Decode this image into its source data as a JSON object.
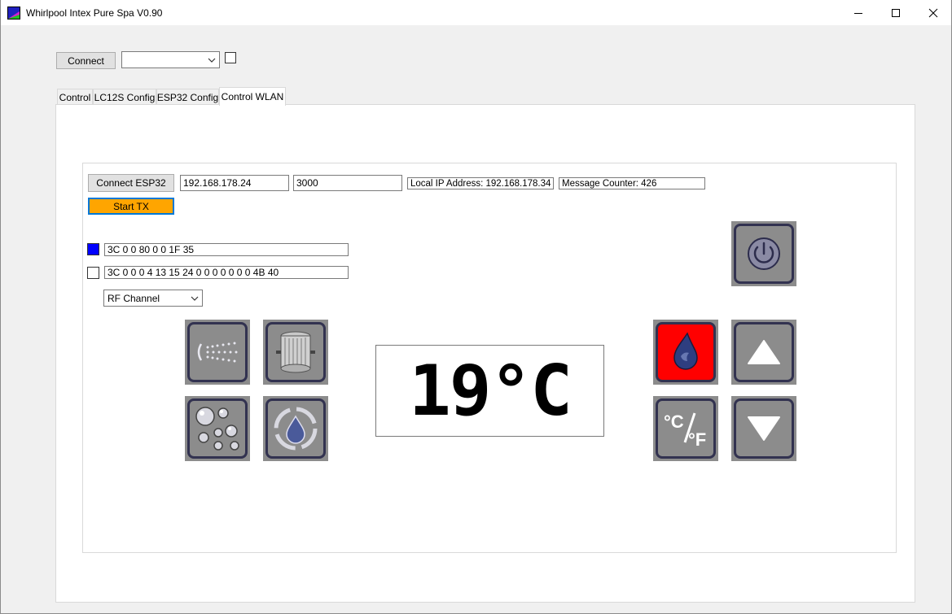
{
  "window": {
    "title": "Whirlpool Intex Pure Spa V0.90"
  },
  "toolbar": {
    "connect_label": "Connect",
    "port_value": ""
  },
  "tabs": [
    {
      "label": "Control"
    },
    {
      "label": "LC12S Config"
    },
    {
      "label": "ESP32 Config"
    },
    {
      "label": "Control WLAN"
    }
  ],
  "wlan": {
    "connect_esp32_label": "Connect ESP32",
    "ip_address": "192.168.178.24",
    "port": "3000",
    "local_ip_label": "Local IP Address: 192.168.178.34",
    "message_counter_label": "Message Counter: 426",
    "start_tx_label": "Start TX",
    "start_tx_color": "#ffa500",
    "rx_line_1": "3C 0 0 80 0 0 1F 35",
    "rx_line_2": "3C 0 0 0 4 13 15 24 0 0 0 0 0 0 0 4B 40",
    "indicator_1_color": "#0000ff",
    "rf_channel_value": "RF Channel",
    "temperature": "19°C",
    "heater_color": "#ff0000",
    "unit_toggle_label": "°C/°F"
  },
  "icons": {
    "jets": "jets-icon",
    "filter": "filter-icon",
    "bubbles": "bubbles-icon",
    "sanitizer": "sanitizer-icon",
    "heater": "heater-flame-icon",
    "up": "arrow-up-icon",
    "down": "arrow-down-icon",
    "power": "power-icon",
    "unit": "celsius-fahrenheit-icon"
  }
}
